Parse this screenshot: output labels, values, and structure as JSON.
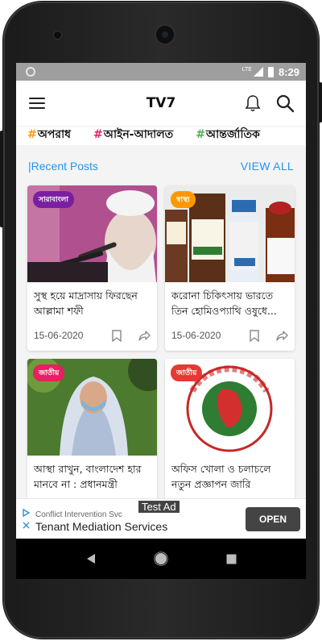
{
  "status_bar": {
    "network": "LTE",
    "time": "8:29"
  },
  "app_bar": {
    "title": "TV7"
  },
  "tags": [
    {
      "hash": "#",
      "label": "অপরাধ",
      "hash_color": "#ff9800"
    },
    {
      "hash": "#",
      "label": "আইন-আদালত",
      "hash_color": "#e91e63"
    },
    {
      "hash": "#",
      "label": "আন্তর্জাতিক",
      "hash_color": "#4caf50"
    }
  ],
  "section": {
    "title": "|Recent Posts",
    "view_all": "VIEW ALL"
  },
  "posts": [
    {
      "badge": "সারাবাংলা",
      "badge_color": "#7b1fa2",
      "title": "সুস্থ হয়ে মাদ্রাসায় ফিরছেন আল্লামা শফী",
      "date": "15-06-2020"
    },
    {
      "badge": "স্বাস্থ্য",
      "badge_color": "#ff9800",
      "title": "করোনা চিকিৎসায় ভারতে তিন হোমিওপ্যাথি ওষুধে...",
      "date": "15-06-2020"
    },
    {
      "badge": "জাতীয়",
      "badge_color": "#e91e63",
      "title": "আস্থা রাখুন, বাংলাদেশ হার মানবে না : প্রধানমন্ত্রী",
      "date": ""
    },
    {
      "badge": "জাতীয়",
      "badge_color": "#e53935",
      "title": "অফিস খোলা ও চলাচলে নতুন প্রজ্ঞাপন জারি",
      "date": ""
    }
  ],
  "ad": {
    "badge": "Test Ad",
    "advertiser": "Conflict Intervention Svc",
    "headline": "Tenant Mediation Services",
    "cta": "OPEN"
  },
  "icons": {
    "menu": "menu-icon",
    "bell": "bell-icon",
    "search": "search-icon",
    "bookmark": "bookmark-icon",
    "share": "share-icon",
    "back": "back-icon",
    "home": "home-icon",
    "recents": "recents-icon"
  }
}
